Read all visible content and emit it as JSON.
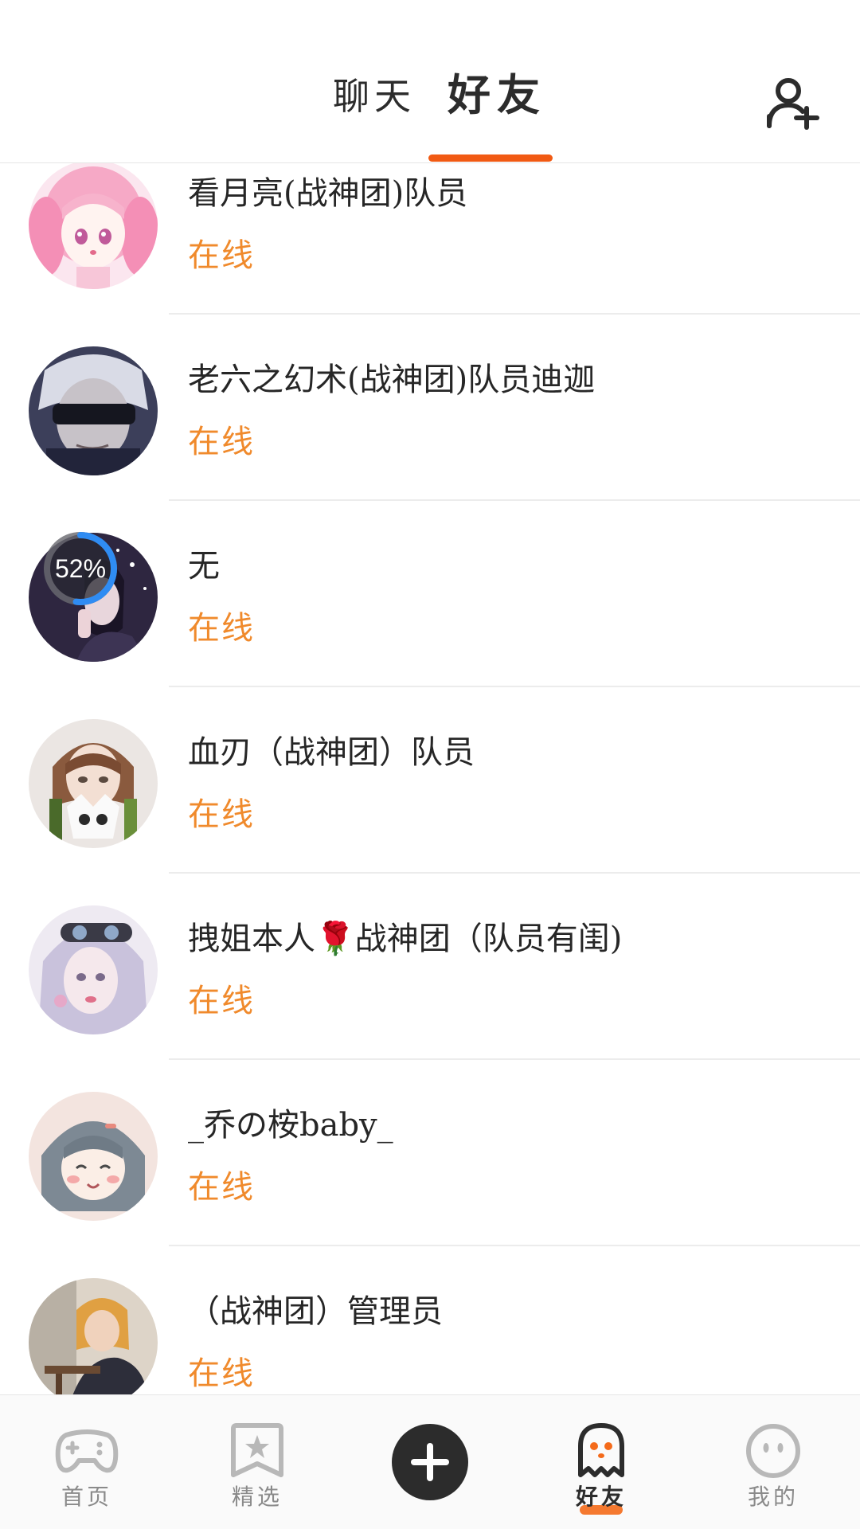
{
  "header": {
    "tabs": [
      {
        "label": "聊天",
        "active": false
      },
      {
        "label": "好友",
        "active": true
      }
    ],
    "add_friend_icon": "add-person-icon",
    "accent_color": "#f15a13"
  },
  "friends": [
    {
      "name": "看月亮(战神团)队员",
      "status": "在线"
    },
    {
      "name": "老六之幻术(战神团)队员迪迦",
      "status": "在线"
    },
    {
      "name": "无",
      "status": "在线",
      "upload_progress": "52%"
    },
    {
      "name": "血刃（战神团）队员",
      "status": "在线"
    },
    {
      "name": "拽姐本人🌹战神团（队员有闺)",
      "status": "在线"
    },
    {
      "name": "_乔の桉baby_",
      "status": "在线"
    },
    {
      "name": "（战神团）管理员",
      "status": "在线"
    }
  ],
  "status_color": "#f08a2c",
  "bottom_nav": {
    "items": [
      {
        "label": "首页",
        "icon": "gamepad-icon"
      },
      {
        "label": "精选",
        "icon": "bookmark-star-icon"
      },
      {
        "label": "",
        "icon": "plus-icon"
      },
      {
        "label": "好友",
        "icon": "ghost-icon",
        "active": true
      },
      {
        "label": "我的",
        "icon": "smiley-face-icon"
      }
    ]
  }
}
